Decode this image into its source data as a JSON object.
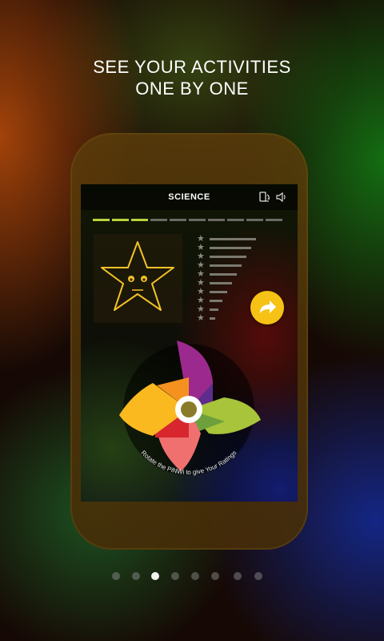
{
  "headline": {
    "line1": "SEE YOUR ACTIVITIES",
    "line2": "ONE BY ONE"
  },
  "app": {
    "title": "SCIENCE",
    "icons": {
      "rotate": "rotate-device-icon",
      "sound": "speaker-icon",
      "next": "forward-arrow-icon",
      "star": "star-face-icon"
    },
    "progress": {
      "total_steps": 10,
      "completed_steps": 3
    },
    "rating_rows": 10,
    "pinwheel_caption": "Rotate the PiNWi to give Your Ratings"
  },
  "pager": {
    "total": 8,
    "active_index": 2
  },
  "colors": {
    "progress_done": "#b9d23a",
    "progress_todo": "#6a6a62",
    "next_button": "#f6c216",
    "star_outline": "#f3c227",
    "pinwheel": [
      "#9c2a8e",
      "#5e2d8c",
      "#a7c43a",
      "#6da03d",
      "#f07070",
      "#d8262f",
      "#fbb920",
      "#f5921f"
    ]
  }
}
